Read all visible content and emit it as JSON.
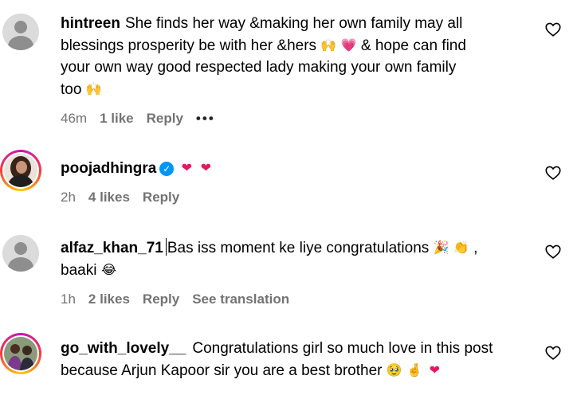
{
  "comments": [
    {
      "username": "hintreen",
      "text_1": "She finds her way &making her own family may all",
      "text_2": "blessings prosperity be with her &hers",
      "text_3": "& hope can find",
      "text_4": "your own way good respected lady making your own family",
      "text_5": "too",
      "emoji_a": "🙌",
      "emoji_b": "💗",
      "emoji_c": "🙌",
      "time": "46m",
      "likes": "1 like",
      "reply": "Reply",
      "more": "•••"
    },
    {
      "username": "poojadhingra",
      "verified_glyph": "✓",
      "emoji_a": "❤",
      "emoji_b": "❤",
      "time": "2h",
      "likes": "4 likes",
      "reply": "Reply"
    },
    {
      "username": "alfaz_khan_71",
      "text_1": "Bas iss moment ke liye congratulations",
      "text_1_end": ",",
      "text_2": "baaki",
      "emoji_a": "🎉",
      "emoji_b": "👏",
      "emoji_c": "😂",
      "time": "1h",
      "likes": "2 likes",
      "reply": "Reply",
      "see_translation": "See translation"
    },
    {
      "username": "go_with_lovely__",
      "text_1": "Congratulations girl so much love in this post",
      "text_2": "because Arjun Kapoor sir you are a best brother",
      "emoji_a": "🥹",
      "emoji_b": "🤞",
      "emoji_c": "❤"
    }
  ],
  "colors": {
    "meta": "#737373",
    "verified": "#0095f6",
    "heart_emoji": "#e8175d"
  },
  "icons": [
    "default-avatar-icon",
    "heart-outline-icon",
    "verified-badge-icon",
    "more-options-icon"
  ]
}
